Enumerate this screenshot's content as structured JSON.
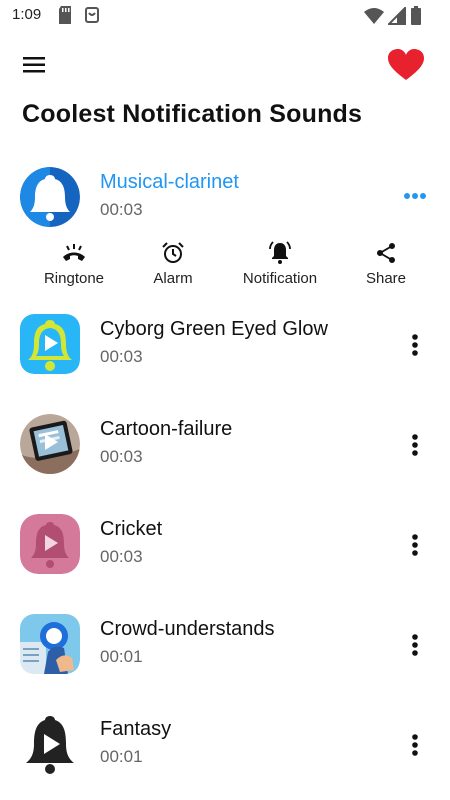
{
  "status_bar": {
    "time": "1:09",
    "icons": [
      "sd-card-icon",
      "app-notification-icon",
      "wifi-icon",
      "signal-icon",
      "battery-icon"
    ]
  },
  "app_bar": {
    "menu_icon": "hamburger-menu-icon",
    "favorite_icon": "heart-icon",
    "accent_color": "#E8212E"
  },
  "page_title": "Coolest Notification Sounds",
  "active_sound": {
    "name": "Musical-clarinet",
    "duration": "00:03",
    "accent_color": "#2196F3",
    "more_icon": "more-horizontal-icon"
  },
  "actions": [
    {
      "label": "Ringtone",
      "icon": "phone-ringtone-icon"
    },
    {
      "label": "Alarm",
      "icon": "alarm-clock-icon"
    },
    {
      "label": "Notification",
      "icon": "notification-bell-icon"
    },
    {
      "label": "Share",
      "icon": "share-icon"
    }
  ],
  "sounds": [
    {
      "name": "Cyborg Green Eyed Glow",
      "duration": "00:03",
      "thumb": "yellow-bell-play-icon"
    },
    {
      "name": "Cartoon-failure",
      "duration": "00:03",
      "thumb": "phone-photo-play-icon"
    },
    {
      "name": "Cricket",
      "duration": "00:03",
      "thumb": "pink-bell-play-icon"
    },
    {
      "name": "Crowd-understands",
      "duration": "00:01",
      "thumb": "blue-illustration-icon"
    },
    {
      "name": "Fantasy",
      "duration": "00:01",
      "thumb": "black-bell-play-icon"
    }
  ]
}
